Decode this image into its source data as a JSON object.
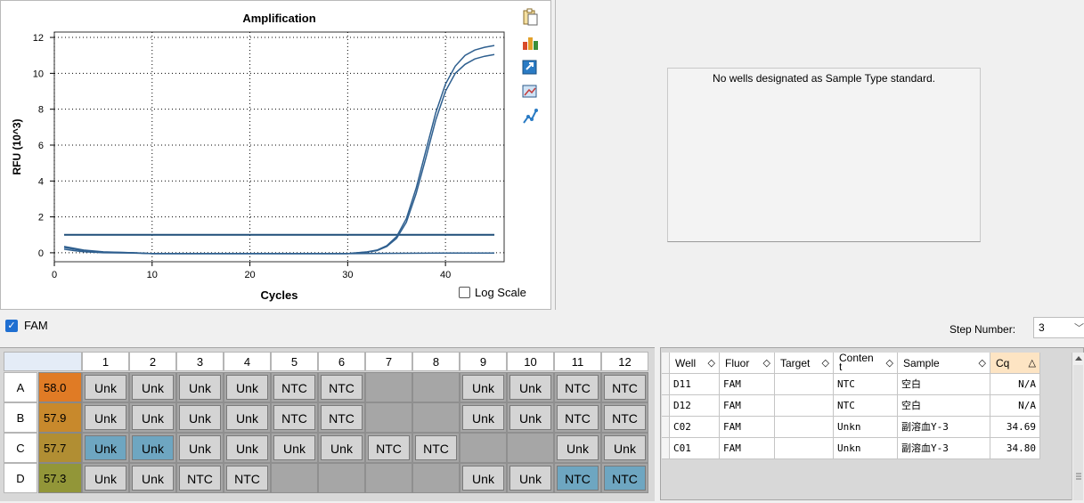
{
  "chart": {
    "title": "Amplification",
    "xlabel": "Cycles",
    "ylabel": "RFU (10^3)",
    "log_scale_label": "Log Scale",
    "log_scale_checked": false
  },
  "chart_data": {
    "type": "line",
    "title": "Amplification",
    "xlabel": "Cycles",
    "ylabel": "RFU (10^3)",
    "xlim": [
      0,
      46
    ],
    "ylim": [
      -0.5,
      12.3
    ],
    "xticks": [
      0,
      10,
      20,
      30,
      40
    ],
    "yticks": [
      0,
      2,
      4,
      6,
      8,
      10,
      12
    ],
    "grid": true,
    "threshold": 1.0,
    "series": [
      {
        "x": [
          1,
          2,
          3,
          5,
          8,
          10,
          20,
          30,
          32,
          33,
          34,
          35,
          36,
          37,
          38,
          39,
          40,
          41,
          42,
          43,
          44,
          45
        ],
        "y": [
          0.35,
          0.25,
          0.15,
          0.05,
          0.0,
          -0.05,
          -0.05,
          -0.05,
          0.05,
          0.15,
          0.4,
          0.9,
          1.9,
          3.6,
          5.7,
          7.8,
          9.4,
          10.4,
          11.0,
          11.3,
          11.45,
          11.55
        ]
      },
      {
        "x": [
          1,
          2,
          3,
          5,
          8,
          10,
          20,
          30,
          32,
          33,
          34,
          35,
          36,
          37,
          38,
          39,
          40,
          41,
          42,
          43,
          44,
          45
        ],
        "y": [
          0.3,
          0.2,
          0.12,
          0.04,
          0.0,
          -0.05,
          -0.05,
          -0.05,
          0.04,
          0.12,
          0.35,
          0.8,
          1.7,
          3.3,
          5.3,
          7.4,
          9.0,
          10.0,
          10.5,
          10.8,
          10.95,
          11.05
        ]
      },
      {
        "x": [
          1,
          2,
          3,
          5,
          8,
          10,
          20,
          30,
          40,
          45
        ],
        "y": [
          0.2,
          0.12,
          0.06,
          0.0,
          -0.02,
          -0.05,
          -0.05,
          -0.05,
          -0.02,
          -0.02
        ]
      }
    ]
  },
  "toolbar_icons": [
    "copy-icon",
    "chart-settings-icon",
    "export-icon",
    "image-icon",
    "series-icon"
  ],
  "standard_panel": {
    "message": "No wells designated as Sample Type standard."
  },
  "fluor_filter": {
    "label": "FAM",
    "checked": true
  },
  "step": {
    "label": "Step Number:",
    "value": "3"
  },
  "plate": {
    "columns": [
      "1",
      "2",
      "3",
      "4",
      "5",
      "6",
      "7",
      "8",
      "9",
      "10",
      "11",
      "12"
    ],
    "rows": [
      {
        "label": "A",
        "temp": "58.0",
        "temp_color": "#e07b25",
        "wells": [
          "Unk",
          "Unk",
          "Unk",
          "Unk",
          "NTC",
          "NTC",
          "",
          "",
          "Unk",
          "Unk",
          "NTC",
          "NTC"
        ],
        "selected": []
      },
      {
        "label": "B",
        "temp": "57.9",
        "temp_color": "#c8892c",
        "wells": [
          "Unk",
          "Unk",
          "Unk",
          "Unk",
          "NTC",
          "NTC",
          "",
          "",
          "Unk",
          "Unk",
          "NTC",
          "NTC"
        ],
        "selected": []
      },
      {
        "label": "C",
        "temp": "57.7",
        "temp_color": "#b18e33",
        "wells": [
          "Unk",
          "Unk",
          "Unk",
          "Unk",
          "Unk",
          "Unk",
          "NTC",
          "NTC",
          "",
          "",
          "Unk",
          "Unk"
        ],
        "selected": [
          0,
          1
        ]
      },
      {
        "label": "D",
        "temp": "57.3",
        "temp_color": "#929638",
        "wells": [
          "Unk",
          "Unk",
          "NTC",
          "NTC",
          "",
          "",
          "",
          "",
          "Unk",
          "Unk",
          "NTC",
          "NTC"
        ],
        "selected": [
          10,
          11
        ]
      }
    ]
  },
  "results_table": {
    "headers": [
      "Well",
      "Fluor",
      "Target",
      "Conten t",
      "Sample",
      "Cq"
    ],
    "rows": [
      [
        "D11",
        "FAM",
        "",
        "NTC",
        "空白",
        "N/A"
      ],
      [
        "D12",
        "FAM",
        "",
        "NTC",
        "空白",
        "N/A"
      ],
      [
        "C02",
        "FAM",
        "",
        "Unkn",
        "副溶血Y-3",
        "34.69"
      ],
      [
        "C01",
        "FAM",
        "",
        "Unkn",
        "副溶血Y-3",
        "34.80"
      ]
    ]
  }
}
